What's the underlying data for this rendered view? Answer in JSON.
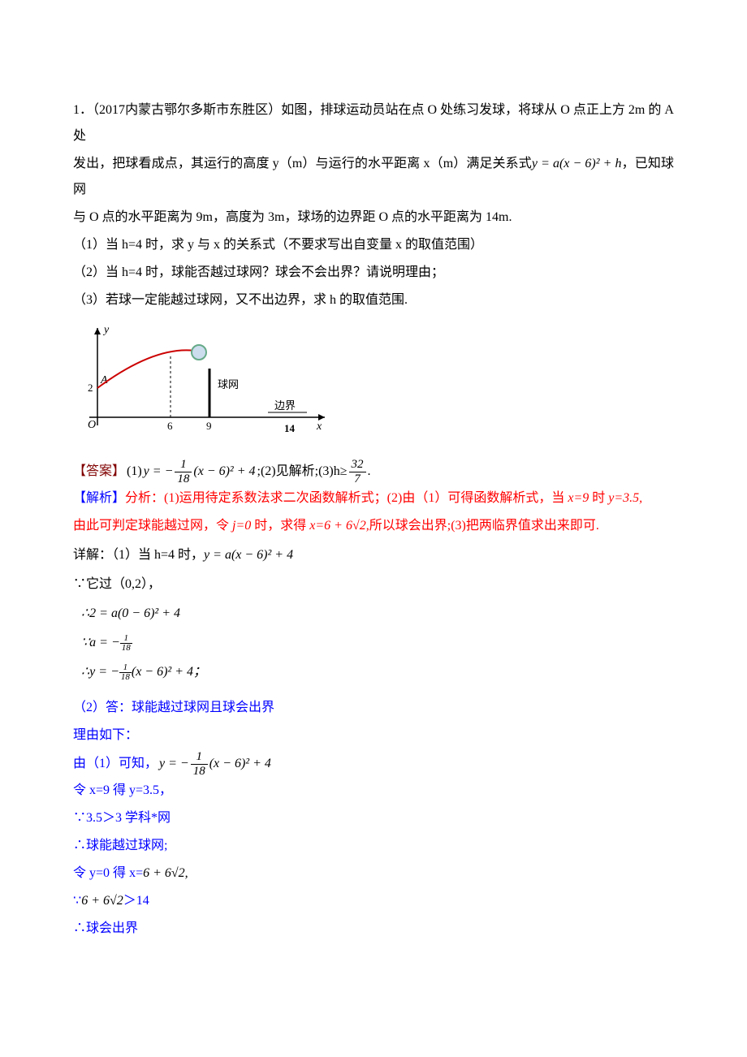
{
  "problem": {
    "line1": "1．（2017内蒙古鄂尔多斯市东胜区）如图，排球运动员站在点 O 处练习发球，将球从 O 点正上方 2m 的 A 处",
    "line2_pre": "发出，把球看成点，其运行的高度 y（m）与运行的水平距离 x（m）满足关系式",
    "line2_formula": "y = a(x − 6)² + h",
    "line2_post": "，已知球网",
    "line3": "与 O 点的水平距离为 9m，高度为 3m，球场的边界距 O 点的水平距离为 14m.",
    "q1": "（1）当 h=4 时，求 y 与 x 的关系式（不要求写出自变量 x 的取值范围）",
    "q2": "（2）当 h=4 时，球能否越过球网？球会不会出界？请说明理由；",
    "q3": "（3）若球一定能越过球网，又不出边界，求 h 的取值范围."
  },
  "diagram": {
    "y_label": "y",
    "x_label": "x",
    "origin": "O",
    "tick2": "2",
    "point_A": "A",
    "tick6": "6",
    "tick9": "9",
    "net_label": "球网",
    "boundary_label": "边界",
    "tick14": "14"
  },
  "answer": {
    "label": "【答案】",
    "part1_pre": "(1) ",
    "part1_formula_lhs": "y = −",
    "part1_formula_rhs": "(x − 6)² + 4",
    "part2": ";(2)见解析;(3)h≥",
    "part3_post": "."
  },
  "analysis": {
    "label": "【解析】",
    "text_pre": "分析：(1)运用待定系数法求二次函数解析式；(2)由（1）可得函数解析式，当 ",
    "text_x9": "x=9",
    "text_mid1": " 时 ",
    "text_y35": "y=3.5,",
    "line2_pre": "由此可判定球能越过网，令 ",
    "line2_j0": "j=0",
    "line2_mid": " 时，求得 ",
    "line2_x": "x=6 + 6√2,",
    "line2_post": "所以球会出界;(3)把两临界值求出来即可."
  },
  "solution": {
    "detail_label": "详解：",
    "s1_pre": "（1）当 h=4 时，",
    "s1_formula": "y = a(x − 6)² + 4",
    "s2": "∵它过（0,2），",
    "s3": "∴2 = a(0 − 6)² + 4",
    "s4_pre": "∵a = −",
    "s5_pre": "∴y = −",
    "s5_post": "(x − 6)² + 4；",
    "part2_title": "（2）答：球能越过球网且球会出界",
    "reason": "理由如下：",
    "by1_pre": "由（1）可知，",
    "by1_lhs": "y = −",
    "by1_rhs": "(x − 6)² + 4",
    "let1": "令 x=9 得 y=3.5，",
    "since1": "∵3.5＞3    学科*网",
    "therefore1": "∴球能越过球网;",
    "let2_pre": "令 ",
    "let2_y": "y=0",
    "let2_mid": " 得 ",
    "let2_x": "x=",
    "let2_val": "6 + 6√2,",
    "since2_pre": "∵",
    "since2_val": "6 + 6√2",
    "since2_post": "＞14",
    "therefore2": "∴球会出界"
  },
  "fractions": {
    "one_eighteen": {
      "num": "1",
      "den": "18"
    },
    "thirtytwo_seven": {
      "num": "32",
      "den": "7"
    }
  }
}
